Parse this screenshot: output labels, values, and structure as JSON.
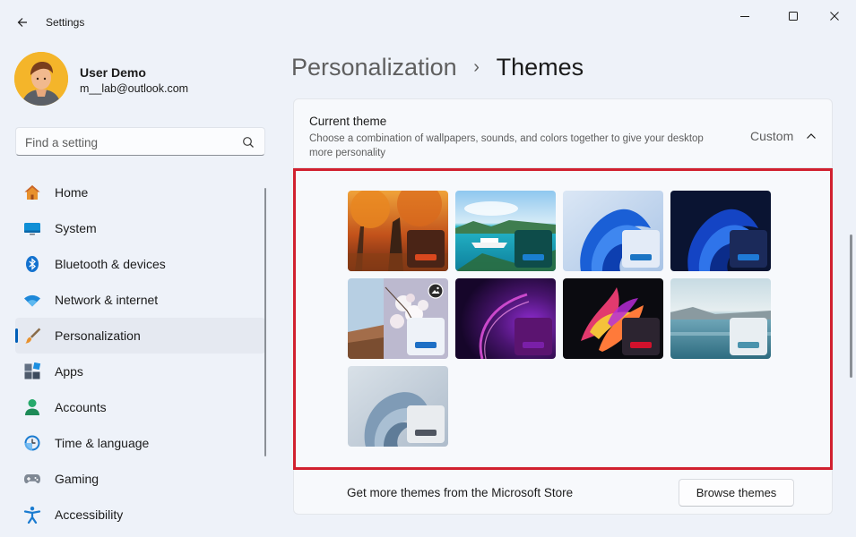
{
  "window": {
    "title": "Settings"
  },
  "profile": {
    "name": "User Demo",
    "email": "m__lab@outlook.com"
  },
  "search": {
    "placeholder": "Find a setting"
  },
  "sidebar": {
    "items": [
      {
        "label": "Home",
        "icon": "home-icon"
      },
      {
        "label": "System",
        "icon": "system-icon"
      },
      {
        "label": "Bluetooth & devices",
        "icon": "bluetooth-icon"
      },
      {
        "label": "Network & internet",
        "icon": "network-icon"
      },
      {
        "label": "Personalization",
        "icon": "personalization-icon",
        "active": true
      },
      {
        "label": "Apps",
        "icon": "apps-icon"
      },
      {
        "label": "Accounts",
        "icon": "accounts-icon"
      },
      {
        "label": "Time & language",
        "icon": "time-language-icon"
      },
      {
        "label": "Gaming",
        "icon": "gaming-icon"
      },
      {
        "label": "Accessibility",
        "icon": "accessibility-icon"
      }
    ]
  },
  "breadcrumb": {
    "parent": "Personalization",
    "separator": "›",
    "current": "Themes"
  },
  "current_theme": {
    "title": "Current theme",
    "description": "Choose a combination of wallpapers, sounds, and colors together to give your desktop more personality",
    "value": "Custom"
  },
  "themes": [
    {
      "name": "autumn-forest",
      "accent": "#d9481e",
      "swatch": "#4a2416"
    },
    {
      "name": "tropical-boat",
      "accent": "#1a7fd0",
      "swatch": "#0e4c4a"
    },
    {
      "name": "windows-light",
      "accent": "#1b74c4",
      "swatch": "#e3ebf7"
    },
    {
      "name": "windows-dark",
      "accent": "#1f7ad6",
      "swatch": "#1b2a5a"
    },
    {
      "name": "flowers-slideshow",
      "accent": "#1e6fc5",
      "swatch": "#eef2f8",
      "slideshow": true
    },
    {
      "name": "glow",
      "accent": "#7a1fa8",
      "swatch": "#5b1470"
    },
    {
      "name": "captured-motion",
      "accent": "#d2112c",
      "swatch": "#2c2430"
    },
    {
      "name": "sunrise-lake",
      "accent": "#4a93ad",
      "swatch": "#e8eef2"
    },
    {
      "name": "flow",
      "accent": "#4f5560",
      "swatch": "#e9ecef"
    }
  ],
  "store": {
    "text": "Get more themes from the Microsoft Store",
    "button": "Browse themes"
  },
  "colors": {
    "accent": "#005fb8",
    "highlight_border": "#d1202f"
  }
}
